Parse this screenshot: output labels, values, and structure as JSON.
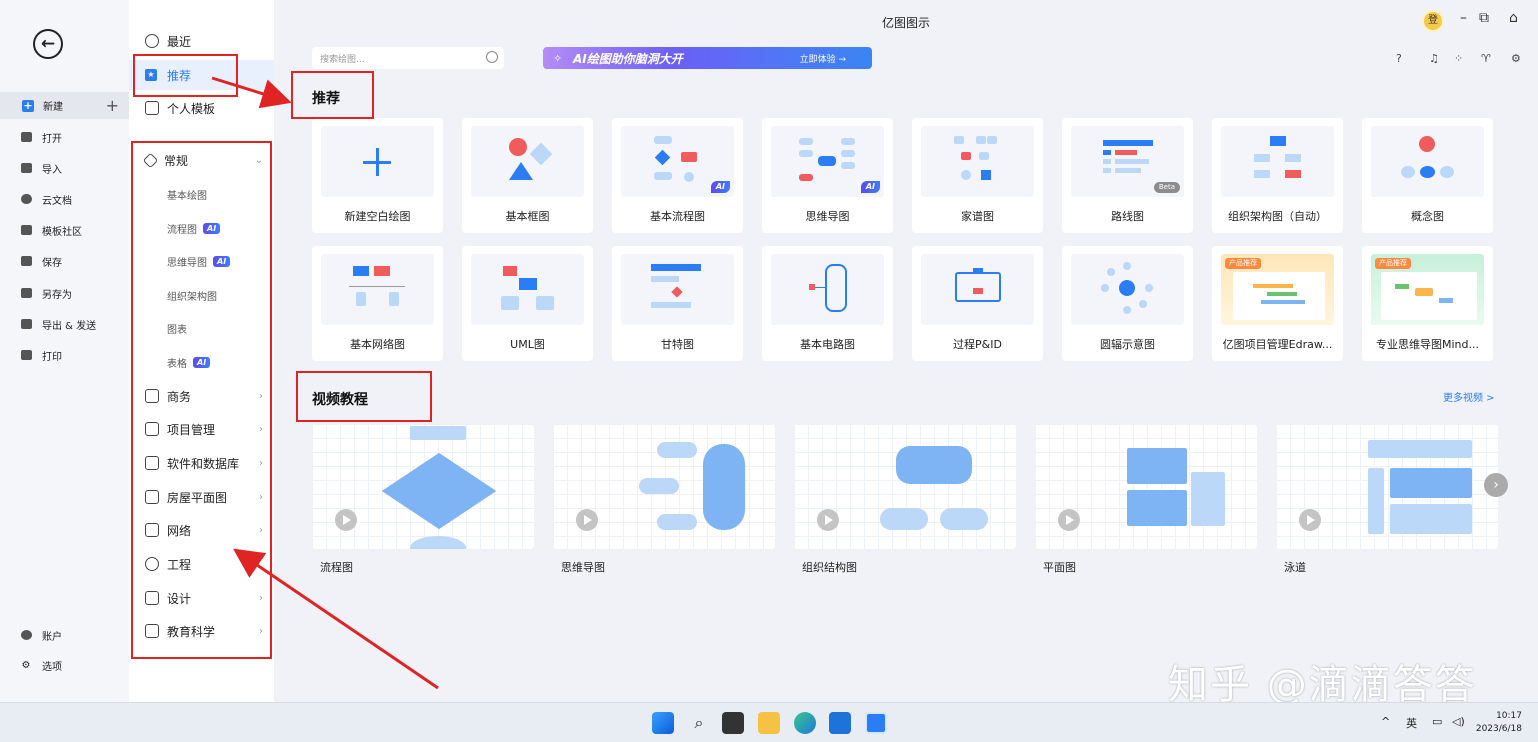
{
  "app_title": "亿图图示",
  "left_nav": {
    "new": "新建",
    "items": [
      "打开",
      "导入",
      "云文档",
      "模板社区",
      "保存",
      "另存为",
      "导出 & 发送",
      "打印"
    ],
    "account": "账户",
    "options": "选项"
  },
  "category_panel": {
    "recent": "最近",
    "recommend": "推荐",
    "personal_templates": "个人模板",
    "general": "常规",
    "sub_items": [
      {
        "label": "基本绘图",
        "ai": ""
      },
      {
        "label": "流程图",
        "ai": "AI"
      },
      {
        "label": "思维导图",
        "ai": "AI"
      },
      {
        "label": "组织架构图",
        "ai": ""
      },
      {
        "label": "图表",
        "ai": ""
      },
      {
        "label": "表格",
        "ai": "AI"
      }
    ],
    "categories": [
      "商务",
      "项目管理",
      "软件和数据库",
      "房屋平面图",
      "网络",
      "工程",
      "设计",
      "教育科学"
    ]
  },
  "search": {
    "placeholder": "搜索绘图..."
  },
  "ai_banner": {
    "text": "AI绘图助你脑洞大开",
    "cta": "立即体验 →"
  },
  "avatar_text": "登",
  "recommend_title": "推荐",
  "templates_row1": [
    {
      "label": "新建空白绘图",
      "tag": ""
    },
    {
      "label": "基本框图",
      "tag": ""
    },
    {
      "label": "基本流程图",
      "tag": "AI"
    },
    {
      "label": "思维导图",
      "tag": "AI"
    },
    {
      "label": "家谱图",
      "tag": ""
    },
    {
      "label": "路线图",
      "tag": "Beta"
    },
    {
      "label": "组织架构图（自动）",
      "tag": ""
    },
    {
      "label": "概念图",
      "tag": ""
    }
  ],
  "templates_row2": [
    {
      "label": "基本网络图",
      "tag": ""
    },
    {
      "label": "UML图",
      "tag": ""
    },
    {
      "label": "甘特图",
      "tag": ""
    },
    {
      "label": "基本电路图",
      "tag": ""
    },
    {
      "label": "过程P&ID",
      "tag": ""
    },
    {
      "label": "圆辐示意图",
      "tag": ""
    },
    {
      "label": "亿图项目管理Edraw...",
      "tag": "产品推荐"
    },
    {
      "label": "专业思维导图Mind...",
      "tag": "产品推荐"
    }
  ],
  "video_title": "视频教程",
  "more_videos": "更多视频 >",
  "videos": [
    "流程图",
    "思维导图",
    "组织结构图",
    "平面图",
    "泳道"
  ],
  "taskbar": {
    "lang": "英",
    "time": "10:17",
    "date": "2023/6/18"
  },
  "watermark": "知乎 @滴滴答答",
  "colors": {
    "accent": "#2b7df6",
    "annotation": "#e02424"
  }
}
